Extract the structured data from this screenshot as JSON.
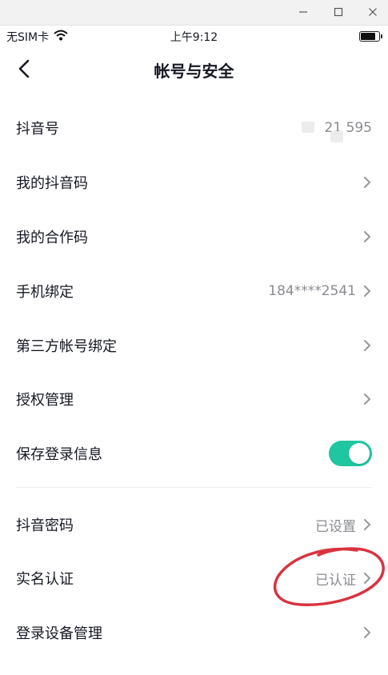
{
  "window": {
    "min_icon": "minimize-icon",
    "max_icon": "maximize-icon",
    "close_icon": "close-icon"
  },
  "status_bar": {
    "carrier": "无SIM卡",
    "time": "上午9:12",
    "battery_level": 0.85
  },
  "nav": {
    "title": "帐号与安全",
    "back_icon": "chevron-left-icon"
  },
  "rows": [
    {
      "label": "抖音号",
      "value": "21     595"
    },
    {
      "label": "我的抖音码",
      "value": ""
    },
    {
      "label": "我的合作码",
      "value": ""
    },
    {
      "label": "手机绑定",
      "value": "184****2541"
    },
    {
      "label": "第三方帐号绑定",
      "value": ""
    },
    {
      "label": "授权管理",
      "value": ""
    },
    {
      "label": "保存登录信息",
      "toggle_on": true
    },
    {
      "label": "抖音密码",
      "value": "已设置"
    },
    {
      "label": "实名认证",
      "value": "已认证"
    },
    {
      "label": "登录设备管理",
      "value": ""
    }
  ],
  "colors": {
    "accent": "#20c6a0",
    "annotation": "#d9333f",
    "secondary_text": "#8a8b91"
  }
}
